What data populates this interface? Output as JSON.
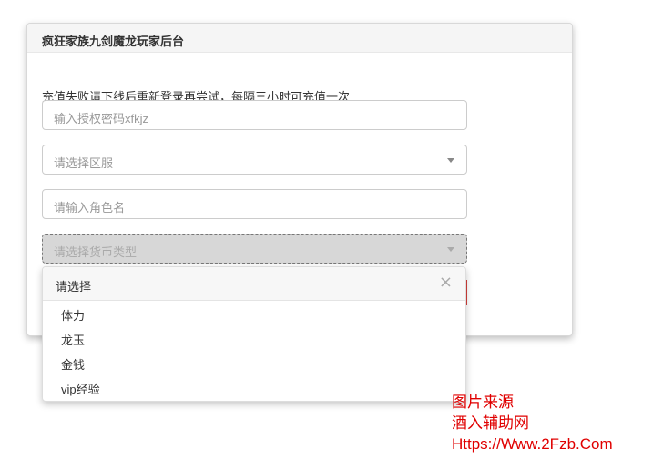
{
  "panel": {
    "title": "疯狂家族九剑魔龙玩家后台",
    "notice": "充值失败请下线后重新登录再尝试，每隔三小时可充值一次"
  },
  "form": {
    "auth_placeholder": "输入授权密码xfkjz",
    "server_placeholder": "请选择区服",
    "role_placeholder": "请输入角色名",
    "currency_placeholder": "请选择货币类型"
  },
  "dropdown": {
    "header": "请选择",
    "close_icon": "close-icon",
    "options": [
      "体力",
      "龙玉",
      "金钱",
      "vip经验"
    ]
  },
  "watermark": {
    "line1": "图片来源",
    "line2": "酒入辅助网",
    "line3": "Https://Www.2Fzb.Com",
    "color": "#e00000"
  }
}
